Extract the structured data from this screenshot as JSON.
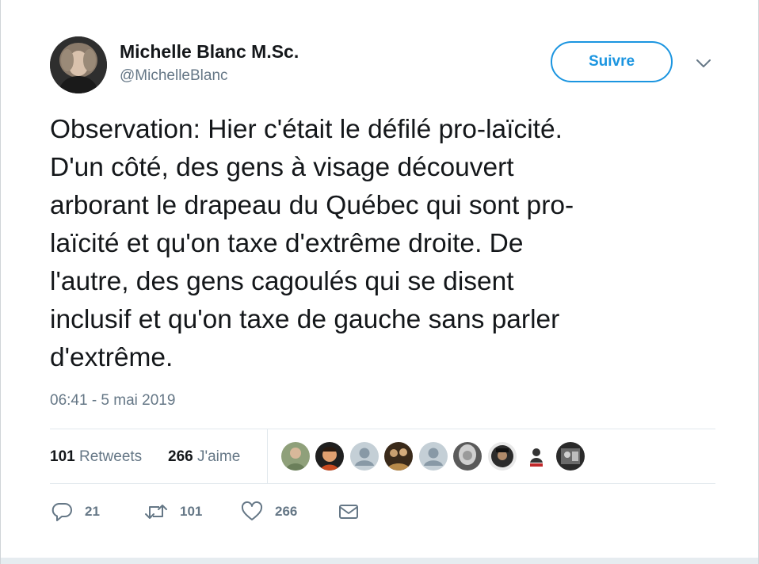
{
  "author": {
    "name": "Michelle Blanc M.Sc.",
    "handle": "@MichelleBlanc"
  },
  "follow_label": "Suivre",
  "tweet": {
    "lines": [
      "Observation: Hier c'était le défilé pro-laïcité.",
      "D'un côté, des gens à visage découvert",
      "arborant le drapeau du Québec qui sont pro-",
      "laïcité et qu'on taxe d'extrême droite. De",
      "l'autre, des gens cagoulés qui se disent",
      "inclusif et qu'on taxe de gauche sans parler",
      "d'extrême."
    ],
    "timestamp": "06:41 - 5 mai 2019"
  },
  "stats": {
    "retweets_count": "101",
    "retweets_label": "Retweets",
    "likes_count": "266",
    "likes_label": "J'aime"
  },
  "actions": {
    "reply_count": "21",
    "retweet_count": "101",
    "like_count": "266"
  },
  "icons": {
    "reply": "reply-icon",
    "retweet": "retweet-icon",
    "like": "heart-icon",
    "dm": "envelope-icon",
    "caret": "chevron-down-icon"
  },
  "colors": {
    "accent": "#1b95e0",
    "secondary_text": "#657786",
    "primary_text": "#14171a",
    "divider": "#e1e8ed"
  }
}
